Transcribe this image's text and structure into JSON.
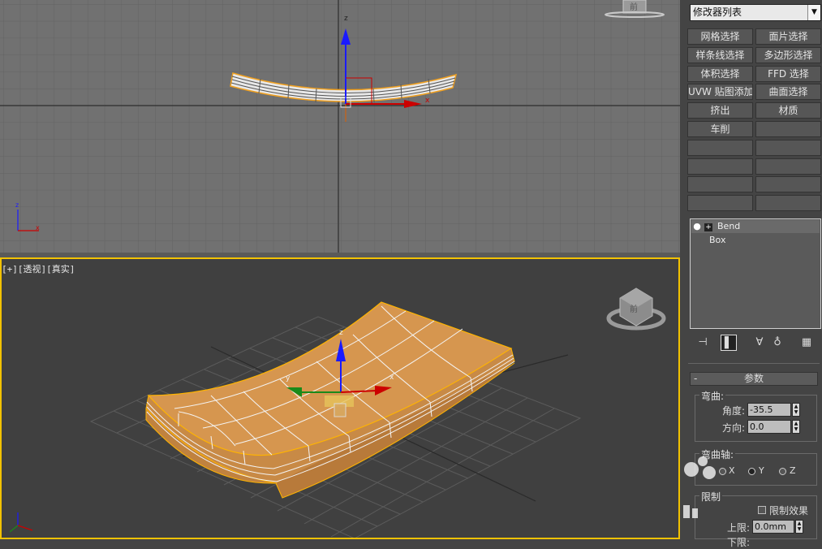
{
  "viewports": {
    "perspective_label": {
      "plus": "[+]",
      "view": "[透视]",
      "shade": "[真实]"
    },
    "view_cube_text": "前",
    "axis_labels": {
      "x": "x",
      "y": "y",
      "z": "z"
    }
  },
  "panel": {
    "modifier_list": "修改器列表",
    "buttons": [
      {
        "label": "网格选择"
      },
      {
        "label": "面片选择"
      },
      {
        "label": "样条线选择"
      },
      {
        "label": "多边形选择"
      },
      {
        "label": "体积选择"
      },
      {
        "label": "FFD 选择"
      },
      {
        "label": "UVW 贴图添加"
      },
      {
        "label": "曲面选择"
      },
      {
        "label": "挤出"
      },
      {
        "label": "材质"
      },
      {
        "label": "车削"
      },
      {
        "label": ""
      },
      {
        "label": ""
      },
      {
        "label": ""
      },
      {
        "label": ""
      },
      {
        "label": ""
      },
      {
        "label": ""
      },
      {
        "label": ""
      },
      {
        "label": ""
      },
      {
        "label": ""
      }
    ],
    "stack": {
      "bend": "Bend",
      "box": "Box"
    },
    "rollout": {
      "collapse": "-",
      "title": "参数",
      "bend_group": "弯曲:",
      "angle_label": "角度:",
      "angle_value": "-35.5",
      "direction_label": "方向:",
      "direction_value": "0.0",
      "axis_group": "弯曲轴:",
      "axis_x": "X",
      "axis_y": "Y",
      "axis_z": "Z",
      "limits_group": "限制",
      "limit_effect": "限制效果",
      "upper_label": "上限:",
      "upper_value": "0.0mm",
      "lower_label": "下限:"
    }
  },
  "colors": {
    "accent": "#f2c200",
    "object": "#d6964f",
    "selected_wire": "#ffb400"
  }
}
